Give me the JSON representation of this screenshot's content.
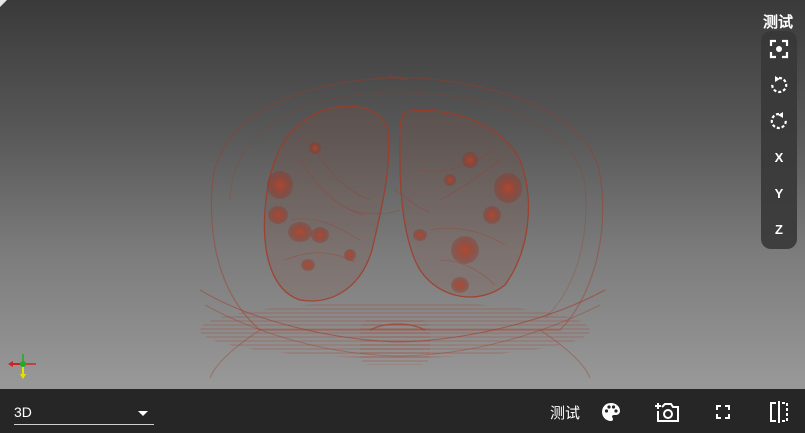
{
  "viewport": {
    "background_top": "#3a3a3a",
    "background_bottom": "#999999",
    "render_color": "#a33a26"
  },
  "right_toolbar": {
    "label": "测试",
    "buttons": [
      {
        "icon": "focus-icon",
        "text": ""
      },
      {
        "icon": "rotate-left-icon",
        "text": ""
      },
      {
        "icon": "rotate-right-icon",
        "text": ""
      },
      {
        "icon": "",
        "text": "X"
      },
      {
        "icon": "",
        "text": "Y"
      },
      {
        "icon": "",
        "text": "Z"
      }
    ]
  },
  "bottom_bar": {
    "view_select": {
      "value": "3D"
    },
    "label": "测试",
    "buttons": [
      "palette-icon",
      "add-camera-icon",
      "fullscreen-icon",
      "split-view-icon"
    ]
  }
}
